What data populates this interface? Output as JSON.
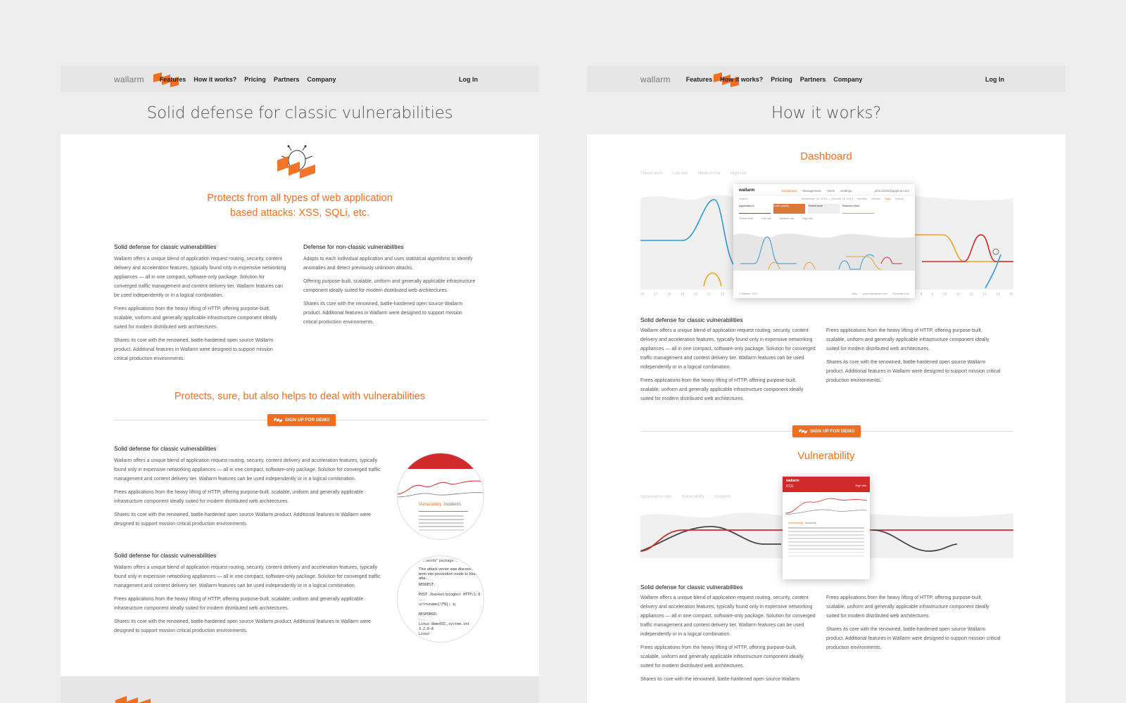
{
  "colors": {
    "accent": "#f26e1f",
    "nav_bg": "#e6e6e6",
    "page_bg": "#eeeeee",
    "chart_blue": "#2e9ad6",
    "chart_red": "#d22a2a",
    "chart_orange": "#f2a21f"
  },
  "left": {
    "nav": {
      "logo": "wallarm",
      "items": [
        "Features",
        "How it works?",
        "Pricing",
        "Partners",
        "Company"
      ],
      "login": "Log In",
      "active_index": 0
    },
    "title": "Solid defense for classic vulnerabilities",
    "hero_icon": "bug-shield-icon",
    "headline_1": "Protects from all types of web application",
    "headline_2": "based attacks: XSS, SQLi, etc.",
    "col1": {
      "title": "Solid defense for classic vulnerabilities",
      "p1": "Wallarm  offers a unique blend of application request routing, security, content delivery and acceleration features, typically found only in expensive networking appliances — all in one compact, software-only package. Solution for converged traffic management and content delivery tier. Wallarm  features can be used independently or in a logical combination.",
      "p2": "Frees applications from the heavy lifting of HTTP, offering purpose-built, scalable, uniform and generally applicable infrastructure component ideally suited for modern distributed web architectures.",
      "p3": "Shares its core with the renowned, battle-hardened open source Wallarm product. Additional features in Wallarm  were designed to support mission critical production environments."
    },
    "col2": {
      "title": "Defense for non-classic vulnerabilities",
      "p1": "Adapts to each individual application and uses statistical algorithms to identify anomalies and detect previously unknown attacks.",
      "p2": "Offering purpose-built, scalable, uniform and generally applicable infrastructure component ideally suited for modern distributed web architectures.",
      "p3": "Shares its core with the renowned, battle-hardened open source Wallarm product. Additional features in Wallarm  were designed to support mission critical production environments."
    },
    "headline_3": "Protects, sure, but also helps to deal with vulnerabilities",
    "demo_button": "SIGN UP FOR DEMO",
    "block1": {
      "title": "Solid defense for classic vulnerabilities",
      "p1": "Wallarm  offers a unique blend of application request routing, security, content delivery and acceleration features, typically found only in expensive networking appliances — all in one compact, software-only package. Solution for converged traffic management and content delivery tier. Wallarm  features can be used independently or in a logical combination.",
      "p2": "Frees applications from the heavy lifting of HTTP, offering purpose-built, scalable, uniform and generally applicable infrastructure component ideally suited for modern distributed web architectures.",
      "p3": "Shares its core with the renowned, battle-hardened open source Wallarm product. Additional features in Wallarm  were designed to support mission critical production environments.",
      "circle_tab1": "Vulnerability",
      "circle_tab2": "Incidents"
    },
    "block2": {
      "title": "Solid defense for classic vulnerabilities",
      "p1": "Wallarm  offers a unique blend of application request routing, security, content delivery and acceleration features, typically found only in expensive networking appliances — all in one compact, software-only package. Solution for converged traffic management and content delivery tier. Wallarm  features can be used independently or in a logical combination.",
      "p2": "Frees applications from the heavy lifting of HTTP, offering purpose-built, scalable, uniform and generally applicable infrastructure component ideally suited for modern distributed web architectures.",
      "p3": "Shares its core with the renowned, battle-hardened open source Wallarm product. Additional features in Wallarm  were designed to support mission critical production environments.",
      "circle_text1": "...words\" package ...",
      "circle_text2": "This attack vector was discovered a...",
      "circle_text3": "term into prevention mode to block atta...",
      "code": [
        "REQUEST:",
        "",
        "POST /basket/pingbot HTTP/1.0",
        "...",
        "url=uname[\\F8]; a;",
        "",
        "RESPONSE:",
        "...",
        "Linux demo0IC.system.int 3.2.0-8",
        "Linux",
        "..."
      ]
    }
  },
  "right": {
    "nav": {
      "logo": "wallarm",
      "items": [
        "Features",
        "How it works?",
        "Pricing",
        "Partners",
        "Company"
      ],
      "login": "Log In",
      "active_index": 1
    },
    "title": "How it works?",
    "dashboard_heading": "Dashboard",
    "dashboard_mock": {
      "logo": "wallarm",
      "tabs": [
        "Dashboard",
        "Management",
        "Alerts",
        "Settings"
      ],
      "user": "john.smith@appline.com",
      "search": "Search",
      "date_range": "September 16, 2013 — October 16, 2013",
      "periods": [
        "Monthly",
        "Weekly",
        "Daily",
        "Hourly"
      ],
      "cards": [
        "Applications",
        "Code quality",
        "Threat level",
        "Reaction time"
      ],
      "legend": [
        "Threat level",
        "Low risk",
        "Medium risk",
        "High risk"
      ],
      "footer_left": "© Wallarm, 2013",
      "footer_links": [
        "Help",
        "support@wallarm.com",
        "Feedback form"
      ]
    },
    "bg_legend": [
      "Threat level",
      "Low risk",
      "Medium risk",
      "High risk"
    ],
    "bg_ticks": [
      "16",
      "17",
      "18",
      "19",
      "20",
      "21",
      "22",
      "23",
      "24",
      "25",
      "26",
      "27",
      "28",
      "29",
      "30",
      "1",
      "2",
      "3",
      "4",
      "5",
      "6",
      "7",
      "8",
      "9",
      "10",
      "11",
      "12",
      "13",
      "14",
      "15"
    ],
    "section1": {
      "title": "Solid defense for classic vulnerabilities",
      "c1p1": "Wallarm  offers a unique blend of application request routing, security, content delivery and acceleration features, typically found only in expensive networking appliances — all in one compact, software-only package. Solution for converged traffic management and content delivery tier. Wallarm  features can be used independently or in a logical combination.",
      "c1p2": "Frees applications from the heavy lifting of HTTP, offering purpose-built, scalable, uniform and generally applicable infrastructure component ideally suited for modern distributed web architectures.",
      "c2p1": "Frees applications from the heavy lifting of HTTP, offering purpose-built, scalable, uniform and generally applicable infrastructure component ideally suited for modern distributed web architectures.",
      "c2p2": "Shares its core with the renowned, battle-hardened open source Wallarm product. Additional features in Wallarm  were designed to support mission critical production environments."
    },
    "demo_button": "SIGN UP FOR DEMO",
    "vulnerability_heading": "Vulnerability",
    "vuln_mock": {
      "logo": "wallarm",
      "title": "RCE",
      "risk": "High risk",
      "tabs": [
        "Vulnerability",
        "Incidents"
      ]
    },
    "vuln_bg_legend": [
      "Appearance rate",
      "Vulnerability",
      "Incidents"
    ],
    "section2": {
      "title": "Solid defense for classic vulnerabilities",
      "c1p1": "Wallarm  offers a unique blend of application request routing, security, content delivery and acceleration features, typically found only in expensive networking appliances — all in one compact, software-only package. Solution for converged traffic management and content delivery tier. Wallarm  features can be used independently or in a logical combination.",
      "c1p2": "Frees applications from the heavy lifting of HTTP, offering purpose-built, scalable, uniform and generally applicable infrastructure component ideally suited for modern distributed web architectures.",
      "c1p3": "Shares its core with the renowned, battle-hardened open source Wallarm",
      "c2p1": "Frees applications from the heavy lifting of HTTP, offering purpose-built, scalable, uniform and generally applicable infrastructure component ideally suited for modern distributed web architectures.",
      "c2p2": "Shares its core with the renowned, battle-hardened open source Wallarm product. Additional features in Wallarm  were designed to support mission critical production environments."
    }
  }
}
